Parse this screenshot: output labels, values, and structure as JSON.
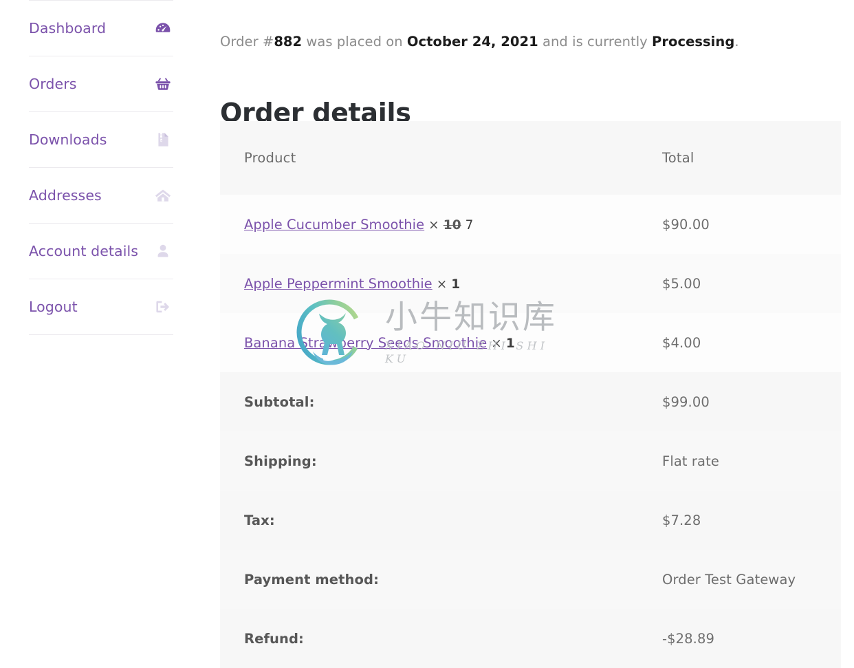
{
  "sidebar": {
    "items": [
      {
        "label": "Dashboard",
        "icon": "dashboard-gauge-icon",
        "icon_style": "solid"
      },
      {
        "label": "Orders",
        "icon": "shopping-basket-icon",
        "icon_style": "solid"
      },
      {
        "label": "Downloads",
        "icon": "zip-file-icon",
        "icon_style": "light"
      },
      {
        "label": "Addresses",
        "icon": "home-icon",
        "icon_style": "light"
      },
      {
        "label": "Account details",
        "icon": "user-person-icon",
        "icon_style": "light"
      },
      {
        "label": "Logout",
        "icon": "logout-arrow-icon",
        "icon_style": "light"
      }
    ]
  },
  "order_status": {
    "prefix": "Order #",
    "order_number": "882",
    "middle": " was placed on ",
    "date": "October 24, 2021",
    "suffix": " and is currently ",
    "status": "Processing",
    "period": "."
  },
  "main": {
    "section_title": "Order details"
  },
  "table": {
    "headers": {
      "product": "Product",
      "total": "Total"
    },
    "rows": [
      {
        "product": "Apple Cucumber Smoothie",
        "qty_separator": "×",
        "qty_old": "10",
        "qty_new": "7",
        "total": "$90.00"
      },
      {
        "product": "Apple Peppermint Smoothie",
        "qty_separator": "×",
        "qty_old": "",
        "qty_new": "1",
        "total": "$5.00"
      },
      {
        "product": "Banana Strawberry Seeds Smoothie",
        "qty_separator": "×",
        "qty_old": "",
        "qty_new": "1",
        "total": "$4.00"
      }
    ],
    "summary": [
      {
        "label": "Subtotal:",
        "value": "$99.00"
      },
      {
        "label": "Shipping:",
        "value": "Flat rate"
      },
      {
        "label": "Tax:",
        "value": "$7.28"
      },
      {
        "label": "Payment method:",
        "value": "Order Test Gateway"
      },
      {
        "label": "Refund:",
        "value": "-$28.89"
      }
    ]
  },
  "watermark": {
    "chinese": "小牛知识库",
    "pinyin": "XIAO NIU ZHI SHI KU",
    "logo_name": "bull-circle-logo"
  },
  "colors": {
    "accent_purple": "#7b52ab",
    "icon_light": "#ded8ea",
    "header_row_bg": "#f7f7f7",
    "heading": "#2c2f33",
    "muted_text": "#8c8c8c"
  }
}
